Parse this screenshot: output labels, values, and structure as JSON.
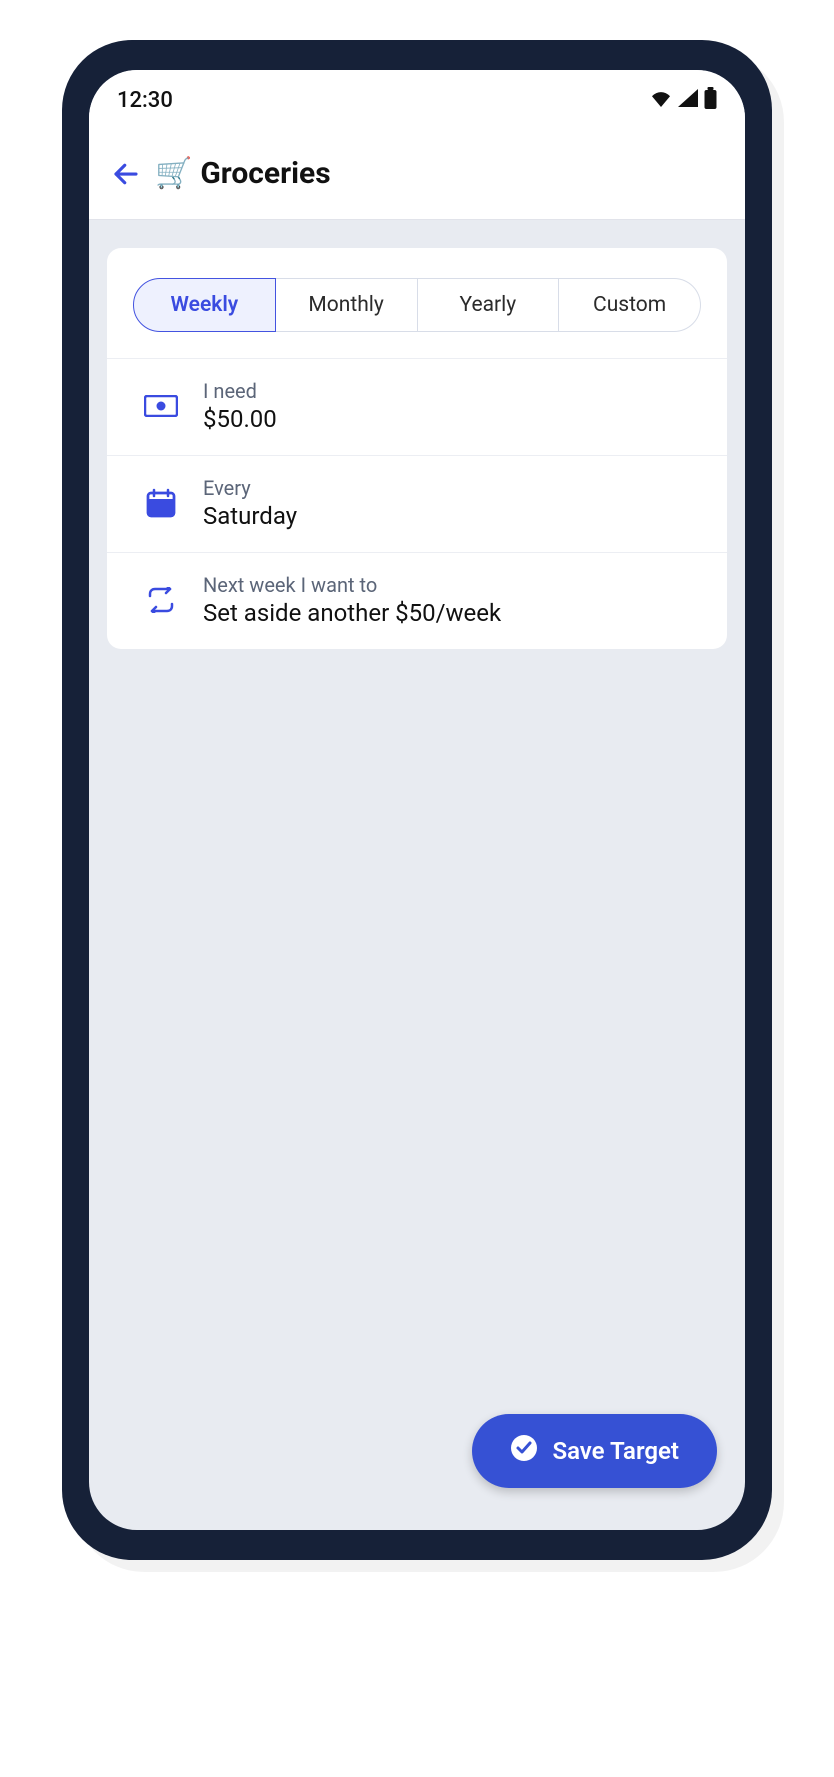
{
  "status": {
    "time": "12:30"
  },
  "header": {
    "icon": "🛒",
    "title": "Groceries"
  },
  "tabs": [
    {
      "label": "Weekly",
      "active": true
    },
    {
      "label": "Monthly",
      "active": false
    },
    {
      "label": "Yearly",
      "active": false
    },
    {
      "label": "Custom",
      "active": false
    }
  ],
  "rows": {
    "amount": {
      "label": "I need",
      "value": "$50.00"
    },
    "every": {
      "label": "Every",
      "value": "Saturday"
    },
    "next": {
      "label": "Next week I want to",
      "value": "Set aside another $50/week"
    }
  },
  "fab": {
    "label": "Save Target"
  },
  "colors": {
    "accent": "#3651d4",
    "deviceBg": "#162138",
    "screenBg": "#e8ebf1"
  }
}
